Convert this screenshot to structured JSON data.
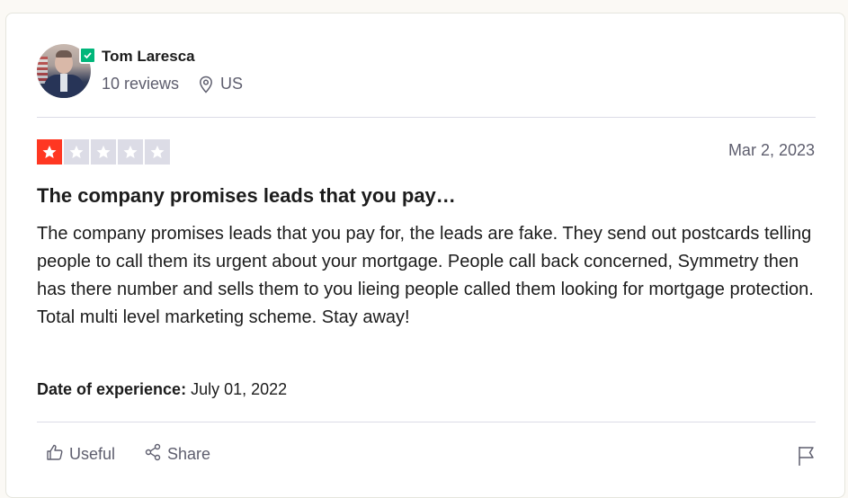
{
  "reviewer": {
    "name": "Tom Laresca",
    "reviews_count": "10 reviews",
    "country": "US",
    "verified": true
  },
  "review": {
    "rating": 1,
    "max_rating": 5,
    "date": "Mar 2, 2023",
    "title": "The company promises leads that you pay…",
    "body": "The company promises leads that you pay for, the leads are fake. They send out postcards telling people to call them its urgent about your mortgage. People call back concerned, Symmetry then has there number and sells them to you lieing people called them looking for mortgage protection. Total multi level marketing scheme. Stay away!",
    "experience_label": "Date of experience:",
    "experience_date": "July 01, 2022"
  },
  "actions": {
    "useful_label": "Useful",
    "share_label": "Share"
  },
  "colors": {
    "star_filled": "#ff3722",
    "star_empty": "#dcdce6",
    "verified": "#00b67a"
  }
}
